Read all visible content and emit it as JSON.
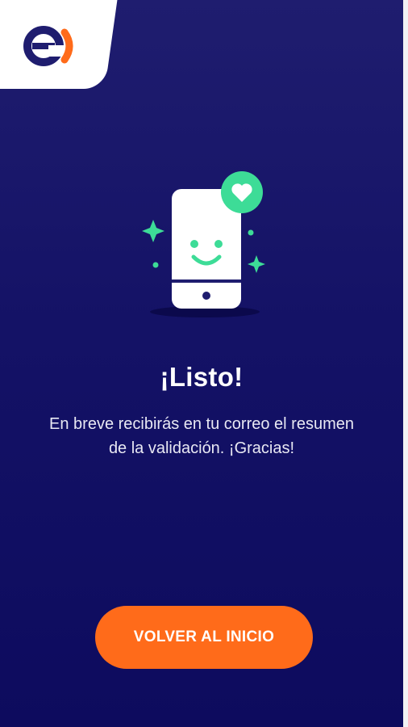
{
  "logo": {
    "icon": "entel-logo-icon",
    "colors": {
      "primary": "#1f1d6f",
      "accent": "#ff6b1a"
    }
  },
  "illustration": {
    "icon": "happy-phone-heart-icon",
    "colors": {
      "phone": "#ffffff",
      "accent": "#3ddc97",
      "dark": "#1f1d6f"
    }
  },
  "confirmation": {
    "title": "¡Listo!",
    "message": "En breve recibirás en tu correo el resumen de la validación. ¡Gracias!"
  },
  "actions": {
    "back_home_label": "VOLVER AL INICIO"
  },
  "colors": {
    "background_top": "#1f1d6f",
    "background_bottom": "#0d0b5e",
    "button": "#ff6b1a",
    "text": "#ffffff"
  }
}
